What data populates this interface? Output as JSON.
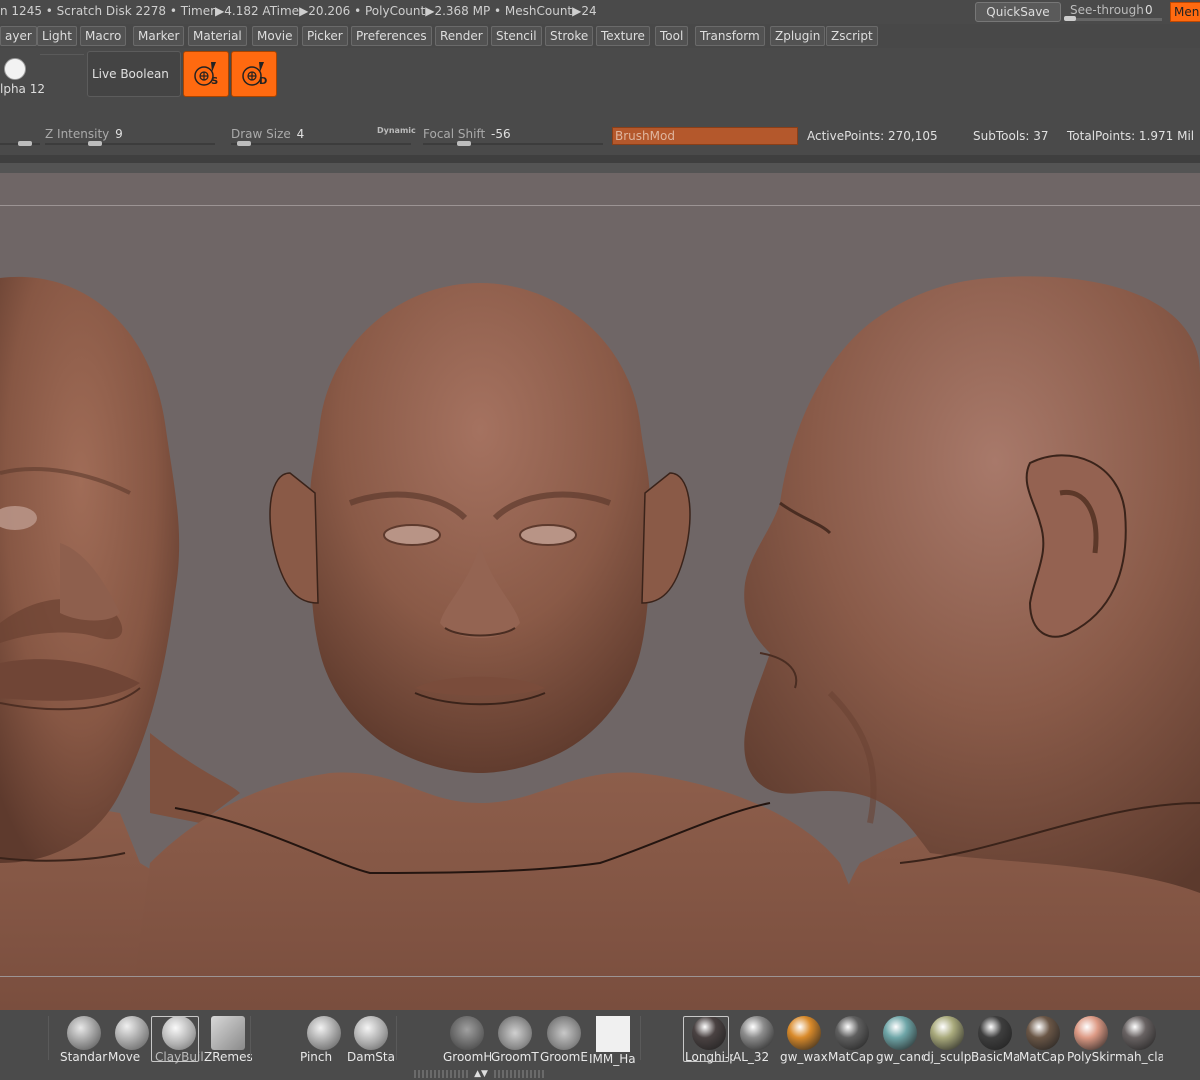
{
  "status_bar": {
    "text": "n 1245 • Scratch Disk 2278 •  Timer▶4.182 ATime▶20.206 • PolyCount▶2.368 MP  • MeshCount▶24",
    "quicksave_label": "QuickSave",
    "see_through_label": "See-through",
    "see_through_value": "0",
    "menus_button_label": "Men"
  },
  "menubar": {
    "items": [
      "ayer",
      "Light",
      "Macro",
      "Marker",
      "Material",
      "Movie",
      "Picker",
      "Preferences",
      "Render",
      "Stencil",
      "Stroke",
      "Texture",
      "Tool",
      "Transform",
      "Zplugin",
      "Zscript"
    ]
  },
  "top_shelf": {
    "alpha_label": "lpha 12",
    "live_boolean_label": "Live Boolean",
    "spotlight_s_letter": "S",
    "spotlight_d_letter": "D"
  },
  "sliders": {
    "z_intensity_label": "Z Intensity",
    "z_intensity_value": "9",
    "draw_size_label": "Draw Size",
    "draw_size_value": "4",
    "dynamic_label": "Dynamic",
    "focal_shift_label": "Focal Shift",
    "focal_shift_value": "-56",
    "brushmod_label": "BrushMod"
  },
  "stats": {
    "active_points": "ActivePoints: 270,105",
    "subtools": "SubTools: 37",
    "total_points": "TotalPoints: 1.971 Mil"
  },
  "viewport": {
    "skin_color": "#8a5a47",
    "background_color": "#6f6666"
  },
  "bottom_shelf": {
    "brushes": [
      {
        "label": "Standar",
        "icon": "standard-brush-icon"
      },
      {
        "label": "Move",
        "icon": "move-brush-icon"
      },
      {
        "label": "ClayBuil",
        "icon": "claybuildup-brush-icon",
        "selected": true
      },
      {
        "label": "ZRemes",
        "icon": "zremesher-icon"
      },
      {
        "label": "Pinch",
        "icon": "pinch-brush-icon"
      },
      {
        "label": "DamSta",
        "icon": "damstandard-brush-icon"
      },
      {
        "label": "GroomH",
        "icon": "groom-hairshort-icon"
      },
      {
        "label": "GroomT",
        "icon": "groom-twist-icon"
      },
      {
        "label": "GroomE",
        "icon": "groom-e-icon"
      },
      {
        "label": "IMM_Ha",
        "icon": "imm-head-icon"
      }
    ],
    "materials": [
      {
        "label": "Longhi-p",
        "color": "#4a4242",
        "selected": true
      },
      {
        "label": "AL_32",
        "color": "#8c8c8c"
      },
      {
        "label": "gw_wax",
        "color": "#d98a2a"
      },
      {
        "label": "MatCap",
        "color": "#5f5f5f"
      },
      {
        "label": "gw_canc",
        "color": "#6fa6a8"
      },
      {
        "label": "dj_sculp",
        "color": "#a9aa7c"
      },
      {
        "label": "BasicMa",
        "color": "#3e3e3e"
      },
      {
        "label": "MatCap",
        "color": "#6a5646"
      },
      {
        "label": "PolySkin",
        "color": "#dd9a85"
      },
      {
        "label": "mah_cla",
        "color": "#686262"
      }
    ]
  }
}
